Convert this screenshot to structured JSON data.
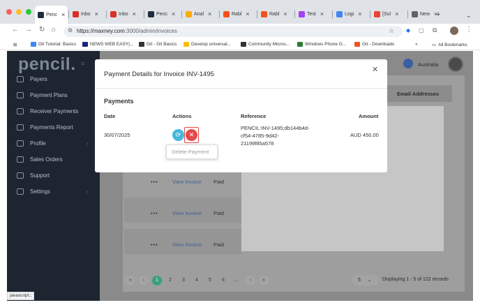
{
  "browser": {
    "tabs": [
      {
        "label": "Penc",
        "favicon_color": "#1f2d3d",
        "active": true
      },
      {
        "label": "Inbo",
        "favicon_color": "#d93025"
      },
      {
        "label": "Inbo",
        "favicon_color": "#d93025"
      },
      {
        "label": "Penc",
        "favicon_color": "#1f2d3d"
      },
      {
        "label": "Anal",
        "favicon_color": "#f9ab00"
      },
      {
        "label": "Rabl",
        "favicon_color": "#f4511e"
      },
      {
        "label": "Rabl",
        "favicon_color": "#f4511e"
      },
      {
        "label": "Test",
        "favicon_color": "#a142f4"
      },
      {
        "label": "Logi",
        "favicon_color": "#4285f4"
      },
      {
        "label": "[Sul",
        "favicon_color": "#ea4335"
      },
      {
        "label": "New",
        "favicon_color": "#5f6368"
      }
    ],
    "url_host": "https://maxney.com",
    "url_path": ":3000/admin/invoices",
    "bookmarks": [
      {
        "label": "Git Tutorial: Basics",
        "color": "#4285f4"
      },
      {
        "label": "NEWS WEB EASY|...",
        "color": "#1a237e"
      },
      {
        "label": "Git - Git Basics",
        "color": "#333333"
      },
      {
        "label": "Develop universal...",
        "color": "#fbbc04"
      },
      {
        "label": "Community Micros...",
        "color": "#333333"
      },
      {
        "label": "Windows Phone G...",
        "color": "#2e7d32"
      },
      {
        "label": "Git - Downloads",
        "color": "#f4511e"
      }
    ],
    "all_bookmarks": "All Bookmarks",
    "status_bar": "javascript:;"
  },
  "app": {
    "logo": "pencil.",
    "region": "Australia",
    "sidebar": [
      {
        "label": "Payers",
        "chevron": false
      },
      {
        "label": "Payment Plans",
        "chevron": false
      },
      {
        "label": "Receiver Payments",
        "chevron": false
      },
      {
        "label": "Payments Report",
        "chevron": false
      },
      {
        "label": "Profile",
        "chevron": true
      },
      {
        "label": "Sales Orders",
        "chevron": false
      },
      {
        "label": "Support",
        "chevron": false
      },
      {
        "label": "Settings",
        "chevron": true
      }
    ],
    "email_header": "Email Addresses",
    "rows": [
      {
        "dots": "•••",
        "link": "View Invoice",
        "status": "Paid"
      },
      {
        "dots": "•••",
        "link": "View Invoice",
        "status": "Paid"
      },
      {
        "dots": "•••",
        "link": "View Invoice",
        "status": "Paid"
      }
    ],
    "pages": [
      "1",
      "2",
      "3",
      "4",
      "5",
      "6",
      "..."
    ],
    "page_size": "5",
    "records": "Displaying 1 - 5 of 122 records"
  },
  "modal": {
    "title": "Payment Details for Invoice INV-1495",
    "close_icon": "close-icon",
    "section": "Payments",
    "headers": {
      "date": "Date",
      "actions": "Actions",
      "reference": "Reference",
      "amount": "Amount"
    },
    "row": {
      "date": "30/07/2025",
      "reference_lines": [
        "PENCIL:INV-1495;db144b4d-",
        "cf54-4785-9d42-",
        "21199f85a578"
      ],
      "amount": "AUD 450.00"
    },
    "tooltip": "Delete Payment",
    "colors": {
      "refresh": "#46b8da",
      "delete": "#e54848"
    }
  }
}
